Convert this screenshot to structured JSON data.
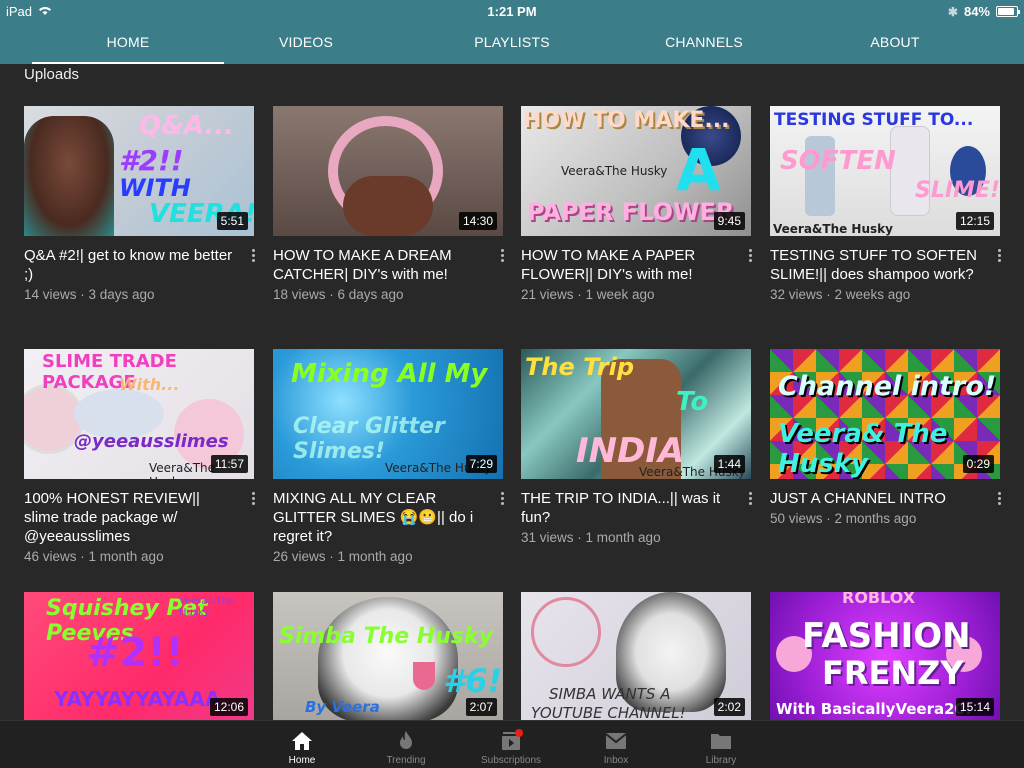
{
  "status": {
    "device": "iPad",
    "time": "1:21 PM",
    "battery": "84%"
  },
  "tabs": [
    "HOME",
    "VIDEOS",
    "PLAYLISTS",
    "CHANNELS",
    "ABOUT"
  ],
  "section_title": "Uploads",
  "videos": [
    {
      "title": "Q&A #2!| get to know me better ;)",
      "meta": "14 views · 3 days ago",
      "duration": "5:51",
      "thumb_text": [
        "Q&A...",
        "#2!!",
        "WITH",
        "VEERA!"
      ]
    },
    {
      "title": "HOW TO MAKE A DREAM CATCHER| DIY's with me!",
      "meta": "18 views · 6 days ago",
      "duration": "14:30"
    },
    {
      "title": "HOW TO MAKE A PAPER FLOWER|| DIY's with me!",
      "meta": "21 views · 1 week ago",
      "duration": "9:45",
      "thumb_text": [
        "HOW TO MAKE...",
        "A",
        "PAPER FLOWER",
        "Veera&The Husky"
      ]
    },
    {
      "title": "TESTING STUFF TO SOFTEN SLIME!|| does shampoo work?",
      "meta": "32 views · 2 weeks ago",
      "duration": "12:15",
      "thumb_text": [
        "TESTING STUFF TO...",
        "SOFTEN",
        "SLIME!",
        "Veera&The Husky"
      ]
    },
    {
      "title": "100% HONEST REVIEW|| slime trade package w/ @yeeausslimes",
      "meta": "46 views · 1 month ago",
      "duration": "11:57",
      "thumb_text": [
        "SLIME TRADE PACKAGE",
        "With...",
        "@yeeausslimes",
        "Veera&The Husky"
      ]
    },
    {
      "title": "MIXING ALL MY CLEAR GLITTER SLIMES 😭😬|| do i regret it?",
      "meta": "26 views · 1 month ago",
      "duration": "7:29",
      "thumb_text": [
        "Mixing All My",
        "Clear Glitter Slimes!",
        "Veera&The Husky"
      ]
    },
    {
      "title": "THE TRIP TO INDIA...|| was it fun?",
      "meta": "31 views · 1 month ago",
      "duration": "1:44",
      "thumb_text": [
        "The Trip",
        "To",
        "INDIA",
        "Veera&The Husky"
      ]
    },
    {
      "title": "JUST A CHANNEL INTRO",
      "meta": "50 views · 2 months ago",
      "duration": "0:29",
      "thumb_text": [
        "Channel intro!",
        "Veera& The Husky"
      ]
    },
    {
      "title": "",
      "meta": "",
      "duration": "12:06",
      "thumb_text": [
        "Squishey Pet Peeves",
        "#2!!",
        "YAYYAYYAYAAA",
        "Veera&The Husky"
      ]
    },
    {
      "title": "",
      "meta": "",
      "duration": "2:07",
      "thumb_text": [
        "Simba The Husky",
        "#6!",
        "By Veera"
      ]
    },
    {
      "title": "",
      "meta": "",
      "duration": "2:02",
      "thumb_text": [
        "SIMBA WANTS A",
        "YOUTUBE CHANNEL!"
      ]
    },
    {
      "title": "",
      "meta": "",
      "duration": "15:14",
      "thumb_text": [
        "ROBLOX",
        "FASHION",
        "FRENZY",
        "With BasicallyVeera20!"
      ]
    }
  ],
  "bottom_nav": [
    "Home",
    "Trending",
    "Subscriptions",
    "Inbox",
    "Library"
  ],
  "colors": {
    "header": "#3c7d8a",
    "background": "#282828",
    "bottom_nav": "#212121"
  }
}
